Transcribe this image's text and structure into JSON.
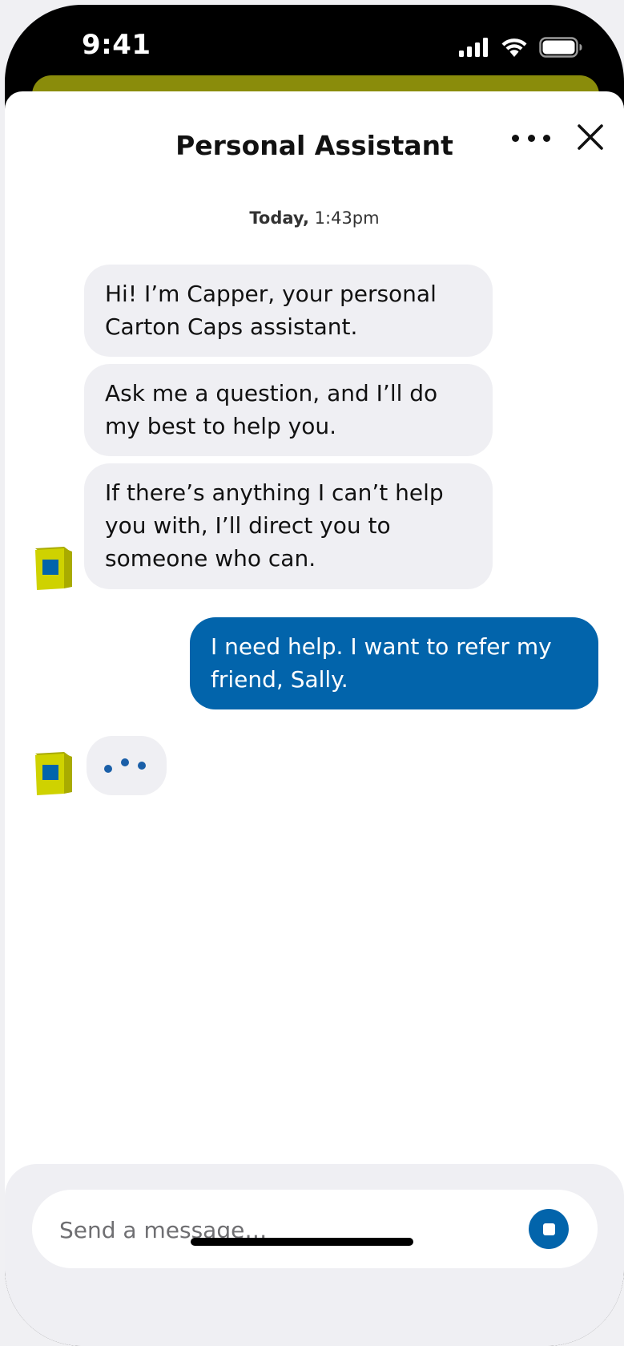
{
  "status_bar": {
    "time": "9:41"
  },
  "header": {
    "title": "Personal Assistant"
  },
  "conversation": {
    "timestamp_day": "Today,",
    "timestamp_time": "1:43pm",
    "messages": [
      {
        "sender": "bot",
        "text": "Hi! I’m Capper, your personal Carton Caps assistant."
      },
      {
        "sender": "bot",
        "text": "Ask me a question, and I’ll do my best to help you."
      },
      {
        "sender": "bot",
        "text": "If there’s anything I can’t help you with, I’ll direct you to someone who can."
      },
      {
        "sender": "user",
        "text": "I need help. I want to refer my friend, Sally."
      }
    ]
  },
  "composer": {
    "placeholder": "Send a message…"
  },
  "colors": {
    "brand_blue": "#0264ab",
    "bubble_gray": "#efeff3",
    "olive": "#8a8c0b",
    "avatar_yellow": "#cfd200"
  },
  "icons": {
    "more": "more-horizontal-icon",
    "close": "close-icon",
    "stop": "stop-icon",
    "avatar": "carton-box-icon"
  }
}
